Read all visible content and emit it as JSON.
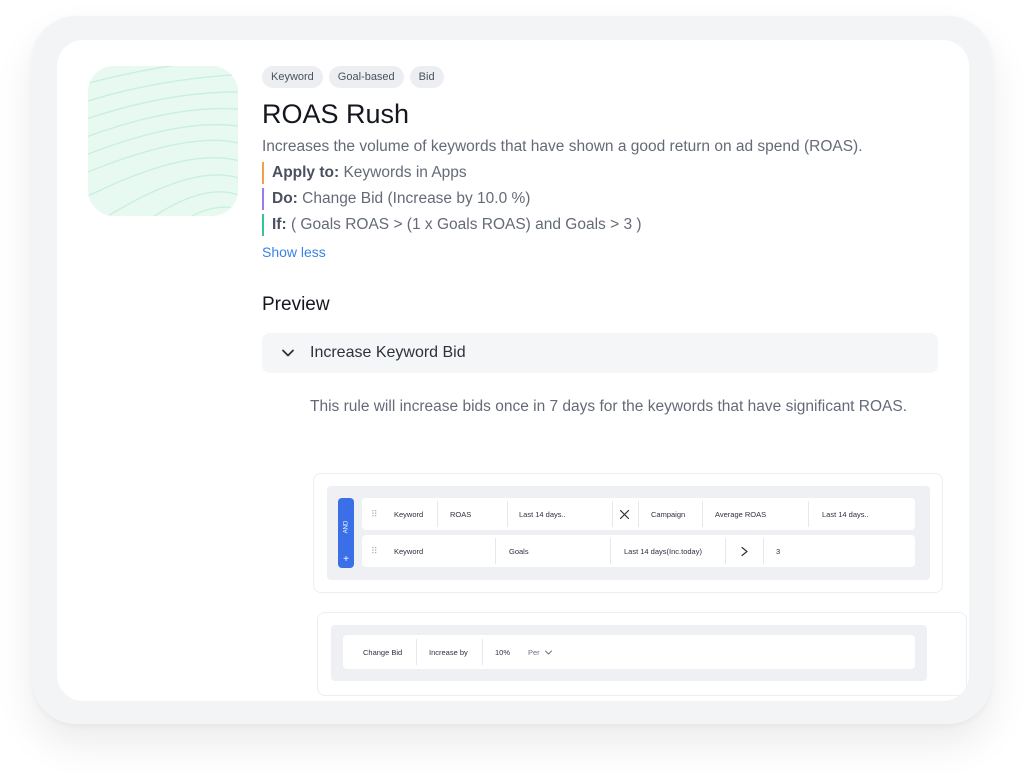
{
  "tags": [
    "Keyword",
    "Goal-based",
    "Bid"
  ],
  "title": "ROAS Rush",
  "description": "Increases the volume of keywords that have shown a good return on ad spend (ROAS).",
  "apply_to": {
    "label": "Apply to:",
    "value": " Keywords in Apps"
  },
  "do": {
    "label": "Do:",
    "value": " Change Bid (Increase by 10.0 %)"
  },
  "if": {
    "label": "If:",
    "value": " ( Goals ROAS > (1 x Goals ROAS) and Goals > 3 )"
  },
  "show_less": "Show less",
  "preview": {
    "heading": "Preview",
    "accordion_label": "Increase Keyword Bid",
    "explanation": "This rule will increase bids once in 7 days for the keywords that have significant ROAS."
  },
  "conditions": {
    "and_label": "AND",
    "plus": "+",
    "row1": [
      "Keyword",
      "ROAS",
      "Last 14 days..",
      "Campaign",
      "Average ROAS",
      "Last 14 days.."
    ],
    "row2": [
      "Keyword",
      "Goals",
      "Last 14 days(Inc.today)",
      "3"
    ]
  },
  "action": {
    "cells": [
      "Change Bid",
      "Increase by",
      "10%",
      "Per"
    ]
  },
  "colors": {
    "accent_blue": "#3b6fe8",
    "apply_border": "#f0a04b",
    "do_border": "#9b7be8",
    "if_border": "#33c49a",
    "link": "#3b82e6"
  }
}
